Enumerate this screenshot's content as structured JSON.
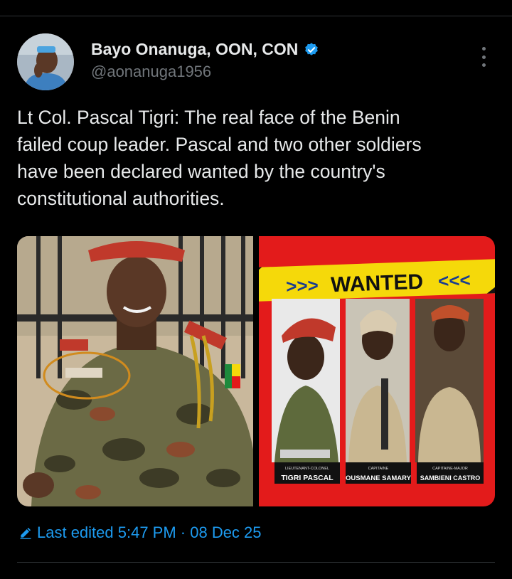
{
  "author": {
    "display_name": "Bayo Onanuga, OON, CON",
    "handle": "@aonanuga1956",
    "verified_color": "#1d9bf0"
  },
  "tweet": {
    "text": "Lt Col. Pascal Tigri: The real face of the Benin\nfailed coup leader. Pascal and two other soldiers\nhave been declared wanted by the country's\nconstitutional authorities."
  },
  "wanted_poster": {
    "banner": "WANTED",
    "people": [
      {
        "rank": "LIEUTENANT-COLONEL",
        "name": "TIGRI PASCAL"
      },
      {
        "rank": "CAPITAINE",
        "name": "OUSMANE SAMARY"
      },
      {
        "rank": "CAPITAINE-MAJOR",
        "name": "SAMBIENI CASTRO"
      }
    ]
  },
  "footer": {
    "edited": "Last edited 5:47 PM · 08 Dec 25"
  },
  "colors": {
    "background": "#000000",
    "text": "#e7e9ea",
    "secondary": "#71767b",
    "accent": "#1d9bf0",
    "poster_red": "#e31b1b",
    "poster_yellow": "#f5d90a"
  }
}
